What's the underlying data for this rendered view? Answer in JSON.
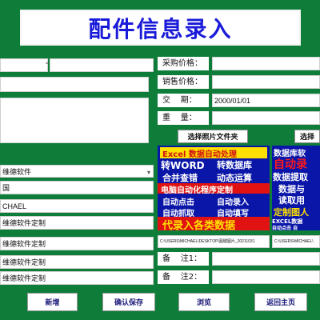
{
  "header": {
    "title": "配件信息录入"
  },
  "left": {
    "dropdown_arrow": "⌄",
    "software_value": "维德软件",
    "country_value": "国",
    "name_value": "CHAEL",
    "custom1_value": "维德软件定制",
    "custom2_value": "维德软件定制",
    "custom3_value": "维德软件定制",
    "custom4_value": "维德软件定制"
  },
  "right": {
    "purchase_price_label": "采购价格：",
    "sale_price_label": "销售价格：",
    "transaction_label": "交    期：",
    "transaction_value": "2000/01/01",
    "weight_label": "重    量：",
    "remark1_label": "备    注1：",
    "remark2_label": "备    注2："
  },
  "photo": {
    "select_button": "选择照片文件夹",
    "select_button2": "选择",
    "path1": "C:\\USERS\\MICHAEL\\DESKTOP\\图键图片_20211031",
    "path2": "C:\\USERS\\MICHAEL\\",
    "ad1_lines": [
      "Excel 数据自动处理",
      "转WORD",
      "转数据库",
      "合并查错",
      "动态运算",
      "电脑自动化程序定制",
      "自动点击",
      "自动录入",
      "自动抓取",
      "自动填写",
      "代录入各类数据"
    ],
    "ad2_lines": [
      "数据库软",
      "自动录",
      "数据提取",
      "数据与",
      "读取用",
      "定制图人",
      "EXCEL数据",
      "自动点击 自"
    ]
  },
  "footer": {
    "add_button": "新增",
    "confirm_button": "确认保存",
    "browse_button": "浏览",
    "back_button": "返回主页"
  },
  "colors": {
    "background": "#0f7d3a",
    "title": "#1a1ad9",
    "ad_bg": "#0a16a8",
    "ad_red": "#ff1a1a",
    "ad_yellow": "#ffe000"
  }
}
